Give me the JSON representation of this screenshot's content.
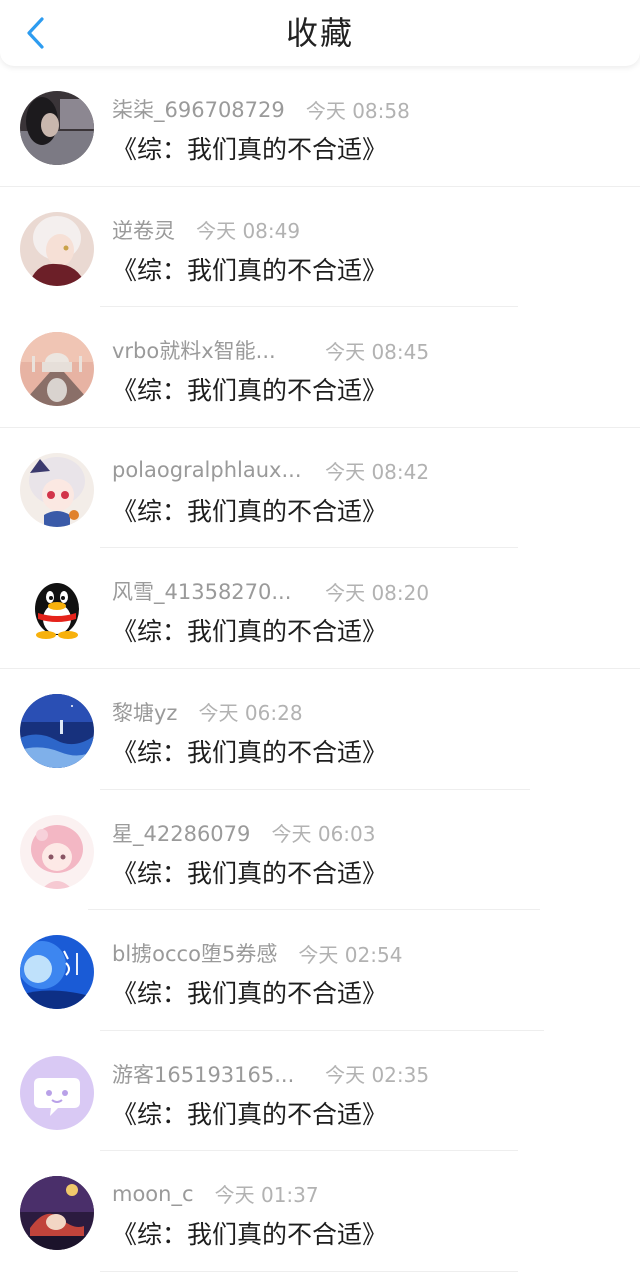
{
  "header": {
    "title": "收藏",
    "accent_color": "#2d9cf0"
  },
  "items": [
    {
      "user": "柒柒_696708729",
      "time": "今天 08:58",
      "book": "《综：我们真的不合适》",
      "avatar": "photo-girl-dark"
    },
    {
      "user": "逆卷灵",
      "time": "今天 08:49",
      "book": "《综：我们真的不合适》",
      "avatar": "anime-boy-white-hair"
    },
    {
      "user": "vrbo就料x智能...",
      "time": "今天 08:45",
      "book": "《综：我们真的不合适》",
      "avatar": "taj-mahal-photo"
    },
    {
      "user": "polaogralphlaux...",
      "time": "今天 08:42",
      "book": "《综：我们真的不合适》",
      "avatar": "anime-girl-red-eyes"
    },
    {
      "user": "风雪_41358270...",
      "time": "今天 08:20",
      "book": "《综：我们真的不合适》",
      "avatar": "qq-penguin"
    },
    {
      "user": "黎塘yz",
      "time": "今天 06:28",
      "book": "《综：我们真的不合适》",
      "avatar": "ocean-night"
    },
    {
      "user": "星_42286079",
      "time": "今天 06:03",
      "book": "《综：我们真的不合适》",
      "avatar": "anime-pink-hair"
    },
    {
      "user": "bl掳occo堕5券感",
      "time": "今天 02:54",
      "book": "《综：我们真的不合适》",
      "avatar": "blue-calligraphy"
    },
    {
      "user": "游客165193165...",
      "time": "今天 02:35",
      "book": "《综：我们真的不合适》",
      "avatar": "chat-bubble-purple"
    },
    {
      "user": "moon_c",
      "time": "今天 01:37",
      "book": "《综：我们真的不合适》",
      "avatar": "anime-night-scene"
    }
  ]
}
